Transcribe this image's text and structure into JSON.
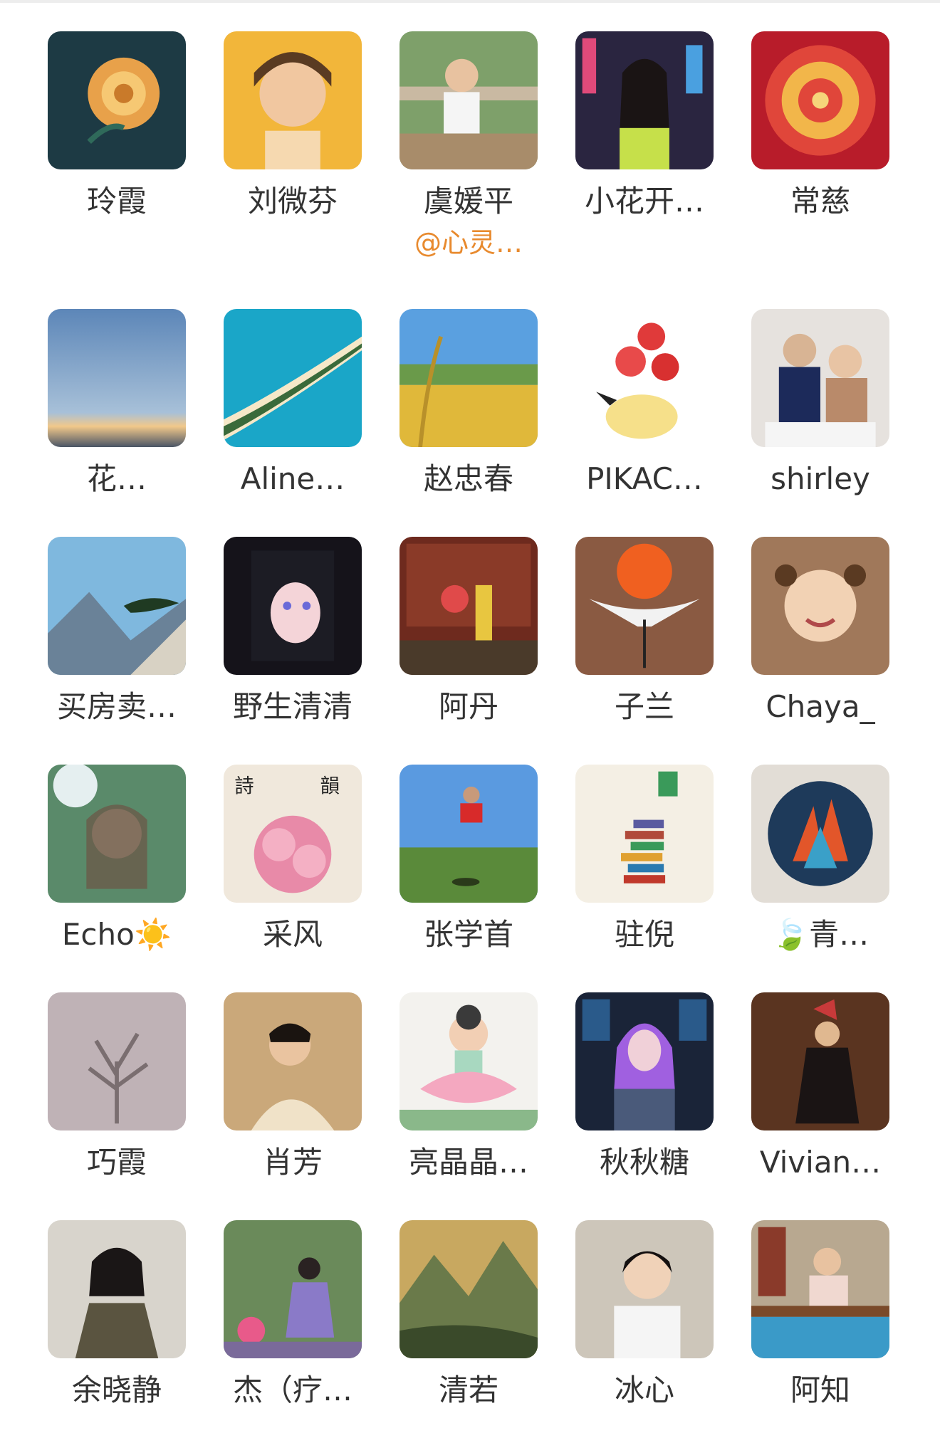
{
  "members": [
    {
      "name": "玲霞",
      "avatar": "golden-rose-avatar"
    },
    {
      "name": "刘微芬",
      "avatar": "smiling-girl-illustration-avatar"
    },
    {
      "name": "虞媛平",
      "role": "@心灵…",
      "avatar": "woman-at-table-avatar"
    },
    {
      "name": "小花开…",
      "avatar": "woman-city-night-avatar"
    },
    {
      "name": "常慈",
      "avatar": "red-mandala-avatar"
    },
    {
      "name": "花…",
      "avatar": "sky-clouds-avatar"
    },
    {
      "name": "Aline…",
      "avatar": "tropical-island-avatar"
    },
    {
      "name": "赵忠春",
      "avatar": "rice-field-avatar"
    },
    {
      "name": "PIKAC…",
      "avatar": "pikachu-strawberries-avatar"
    },
    {
      "name": "shirley",
      "avatar": "mother-and-child-avatar"
    },
    {
      "name": "买房卖…",
      "avatar": "mountain-pine-avatar"
    },
    {
      "name": "野生清清",
      "avatar": "anime-girl-avatar"
    },
    {
      "name": "阿丹",
      "avatar": "woman-in-hall-avatar"
    },
    {
      "name": "子兰",
      "avatar": "crane-sunset-avatar"
    },
    {
      "name": "Chaya_",
      "avatar": "little-girl-avatar"
    },
    {
      "name": "Echo☀️",
      "avatar": "woman-sunlight-avatar"
    },
    {
      "name": "采风",
      "avatar": "pink-lilies-avatar"
    },
    {
      "name": "张学首",
      "avatar": "man-jumping-grassland-avatar"
    },
    {
      "name": "驻倪",
      "avatar": "stacked-books-avatar"
    },
    {
      "name": "🍃青…",
      "avatar": "abstract-plate-avatar"
    },
    {
      "name": "巧霞",
      "avatar": "bare-tree-avatar"
    },
    {
      "name": "肖芳",
      "avatar": "woman-sweater-avatar"
    },
    {
      "name": "亮晶晶…",
      "avatar": "lotus-child-avatar"
    },
    {
      "name": "秋秋糖",
      "avatar": "cyber-girl-avatar"
    },
    {
      "name": "Vivian…",
      "avatar": "dancer-costume-avatar"
    },
    {
      "name": "余晓静",
      "avatar": "woman-scarf-avatar"
    },
    {
      "name": "杰（疗…",
      "avatar": "woman-garden-avatar"
    },
    {
      "name": "清若",
      "avatar": "landscape-painting-avatar"
    },
    {
      "name": "冰心",
      "avatar": "short-hair-woman-avatar"
    },
    {
      "name": "阿知",
      "avatar": "tea-ceremony-avatar"
    }
  ],
  "colors": {
    "name_text": "#333333",
    "role_text": "#e88a2e",
    "divider": "#ededed"
  }
}
